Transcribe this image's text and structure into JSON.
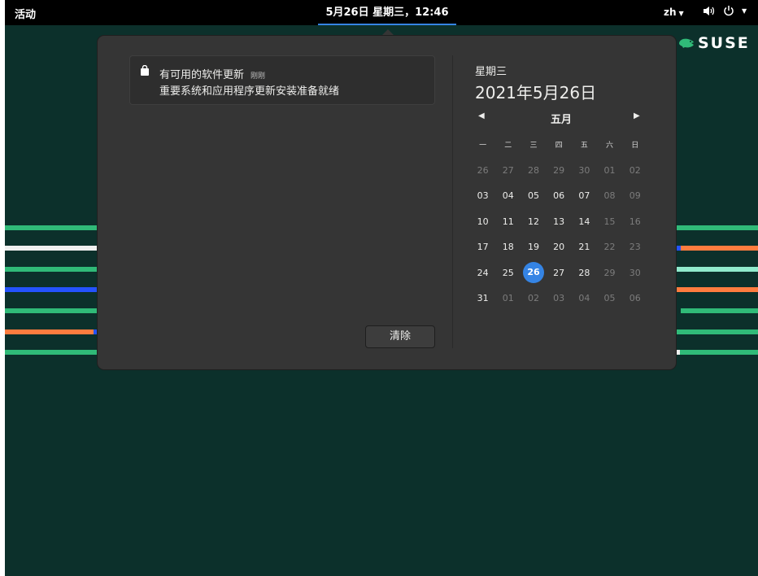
{
  "topbar": {
    "activities_label": "活动",
    "clock_label": "5月26日 星期三，12:46",
    "language_label": "zh",
    "volume_icon": "volume-icon",
    "power_icon": "power-icon"
  },
  "brand": {
    "logo_text": "SUSE"
  },
  "notification": {
    "icon": "shopping-bag-icon",
    "title": "有可用的软件更新",
    "time": "刚刚",
    "body": "重要系统和应用程序更新安装准备就绪"
  },
  "clear_label": "清除",
  "calendar": {
    "weekday": "星期三",
    "full_date": "2021年5月26日",
    "month": "五月",
    "weekday_headers": [
      "一",
      "二",
      "三",
      "四",
      "五",
      "六",
      "日"
    ],
    "weeks": [
      [
        "26",
        "27",
        "28",
        "29",
        "30",
        "01",
        "02"
      ],
      [
        "03",
        "04",
        "05",
        "06",
        "07",
        "08",
        "09"
      ],
      [
        "10",
        "11",
        "12",
        "13",
        "14",
        "15",
        "16"
      ],
      [
        "17",
        "18",
        "19",
        "20",
        "21",
        "22",
        "23"
      ],
      [
        "24",
        "25",
        "26",
        "27",
        "28",
        "29",
        "30"
      ],
      [
        "31",
        "01",
        "02",
        "03",
        "04",
        "05",
        "06"
      ]
    ],
    "today": "26",
    "accent_color": "#3584e4"
  },
  "colors": {
    "desktop": "#0c302b",
    "panel": "#353535",
    "stripe_green": "#30ba78",
    "stripe_blue": "#2453ff",
    "stripe_orange": "#fe7c3f",
    "stripe_white": "#efefef",
    "stripe_mint": "#90ebcd"
  }
}
